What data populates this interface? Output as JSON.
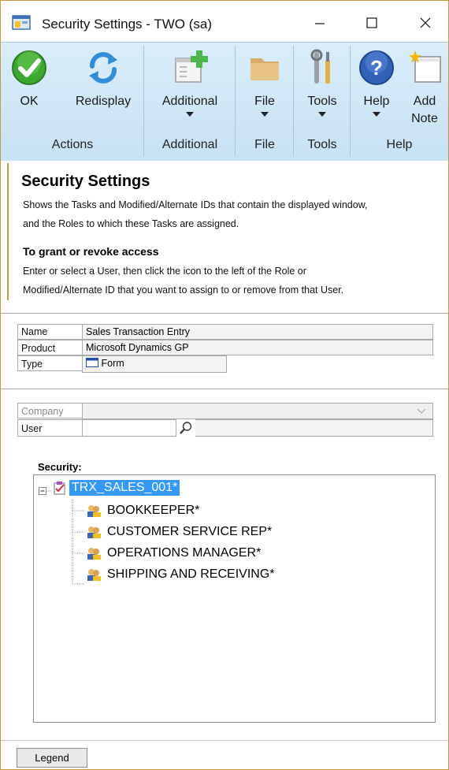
{
  "window": {
    "title": "Security Settings  -  TWO (sa)"
  },
  "ribbon": {
    "groups": [
      {
        "label": "Actions",
        "buttons": [
          {
            "label": "OK",
            "icon": "ok-check-icon"
          },
          {
            "label": "Redisplay",
            "icon": "redisplay-arrows-icon"
          }
        ]
      },
      {
        "label": "Additional",
        "buttons": [
          {
            "label": "Additional",
            "icon": "additional-window-plus-icon"
          }
        ]
      },
      {
        "label": "File",
        "buttons": [
          {
            "label": "File",
            "icon": "folder-icon"
          }
        ]
      },
      {
        "label": "Tools",
        "buttons": [
          {
            "label": "Tools",
            "icon": "tools-wrench-icon"
          }
        ]
      },
      {
        "label": "Help",
        "buttons": [
          {
            "label": "Help",
            "icon": "help-question-icon"
          },
          {
            "label": "Add Note",
            "icon": "add-note-icon"
          }
        ]
      }
    ]
  },
  "description": {
    "title": "Security Settings",
    "line1": "Shows the Tasks and Modified/Alternate IDs that contain the displayed window,",
    "line2": "and the Roles to which these Tasks are assigned.",
    "subtitle": "To grant or revoke access",
    "line3": "Enter or select a User, then click the icon to the left of the Role or",
    "line4": "Modified/Alternate ID that you want to assign to or remove from that User."
  },
  "info": {
    "name_label": "Name",
    "name_value": "Sales Transaction Entry",
    "product_label": "Product",
    "product_value": "Microsoft Dynamics GP",
    "type_label": "Type",
    "type_value": "Form"
  },
  "company": {
    "label": "Company",
    "value": ""
  },
  "user": {
    "label": "User",
    "value": ""
  },
  "security": {
    "label": "Security:",
    "root": "TRX_SALES_001*",
    "children": [
      "BOOKKEEPER*",
      "CUSTOMER SERVICE REP*",
      "OPERATIONS MANAGER*",
      "SHIPPING AND RECEIVING*"
    ]
  },
  "footer": {
    "legend_label": "Legend"
  },
  "colors": {
    "ribbon_bg": "#c6e2f5",
    "selection": "#3399ff",
    "accent_border": "#c49a3a"
  }
}
